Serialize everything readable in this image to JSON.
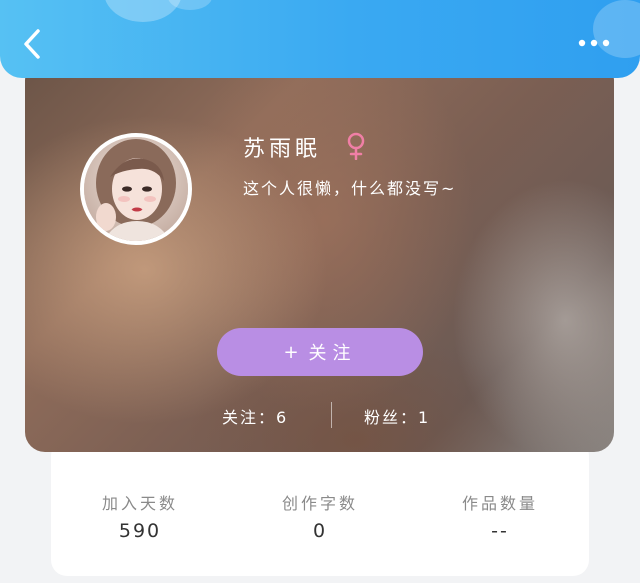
{
  "profile": {
    "username": "苏雨眠",
    "bio": "这个人很懒，什么都没写~",
    "gender_icon": "female-icon",
    "follow_button": {
      "plus": "+",
      "label": "关注"
    },
    "following": "关注：6",
    "fans": "粉丝：1"
  },
  "metrics": [
    {
      "label": "加入天数",
      "value": "590"
    },
    {
      "label": "创作字数",
      "value": "0"
    },
    {
      "label": "作品数量",
      "value": "--"
    }
  ],
  "colors": {
    "header": "#3aa9f2",
    "follow_button": "#b98ee4",
    "female_icon": "#f07fa6"
  }
}
